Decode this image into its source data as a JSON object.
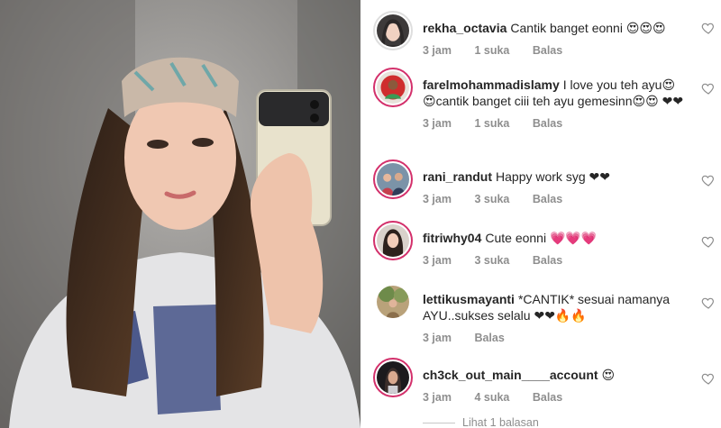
{
  "comments": [
    {
      "username": "rekha_octavia",
      "text": "Cantik banget eonni 😍😍😍",
      "time": "3 jam",
      "likes": "1 suka",
      "reply": "Balas",
      "avatar_icon": "avatar-woman-hijab",
      "heart_icon": "heart-outline-icon"
    },
    {
      "username": "farelmohammadislamy",
      "text": "I love you teh ayu😍 😍cantik banget ciii teh ayu gemesinn😍😍 ❤❤",
      "time": "3 jam",
      "likes": "1 suka",
      "reply": "Balas",
      "avatar_icon": "avatar-man-red-bg",
      "heart_icon": "heart-outline-icon"
    },
    {
      "username": "rani_randut",
      "text": "Happy work syg ❤❤",
      "time": "3 jam",
      "likes": "3 suka",
      "reply": "Balas",
      "avatar_icon": "avatar-family",
      "heart_icon": "heart-outline-icon"
    },
    {
      "username": "fitriwhy04",
      "text": "Cute eonni 💗💗💗",
      "time": "3 jam",
      "likes": "3 suka",
      "reply": "Balas",
      "avatar_icon": "avatar-woman",
      "heart_icon": "heart-outline-icon"
    },
    {
      "username": "lettikusmayanti",
      "text": "*CANTIK* sesuai namanya AYU..sukses selalu ❤❤🔥🔥",
      "time": "3 jam",
      "likes": "",
      "reply": "Balas",
      "avatar_icon": "avatar-outdoor",
      "heart_icon": "heart-outline-icon"
    },
    {
      "username": "ch3ck_out_main____account",
      "text": "😍",
      "time": "3 jam",
      "likes": "4 suka",
      "reply": "Balas",
      "avatar_icon": "avatar-woman-dark",
      "heart_icon": "heart-outline-icon"
    }
  ],
  "view_replies": "Lihat 1 balasan",
  "colors": {
    "story_ring": "#d3306b",
    "meta_text": "#8e8e8e",
    "text": "#262626"
  }
}
